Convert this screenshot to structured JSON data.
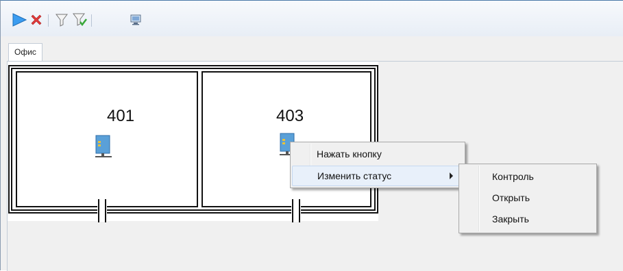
{
  "toolbar": {
    "buttons": [
      {
        "name": "play-icon"
      },
      {
        "name": "close-icon"
      },
      {
        "name": "filter-icon"
      },
      {
        "name": "filter-apply-icon"
      },
      {
        "name": "monitor-icon"
      }
    ]
  },
  "tabs": [
    {
      "label": "Офис"
    }
  ],
  "plan": {
    "rooms": [
      {
        "label": "401"
      },
      {
        "label": "403"
      }
    ]
  },
  "context_menu": {
    "items": [
      {
        "label": "Нажать кнопку"
      },
      {
        "label": "Изменить статус"
      }
    ]
  },
  "submenu": {
    "items": [
      {
        "label": "Контроль"
      },
      {
        "label": "Открыть"
      },
      {
        "label": "Закрыть"
      }
    ]
  },
  "colors": {
    "play": "#2a8ee8",
    "close": "#e0343a",
    "device": "#5aa0d8"
  }
}
